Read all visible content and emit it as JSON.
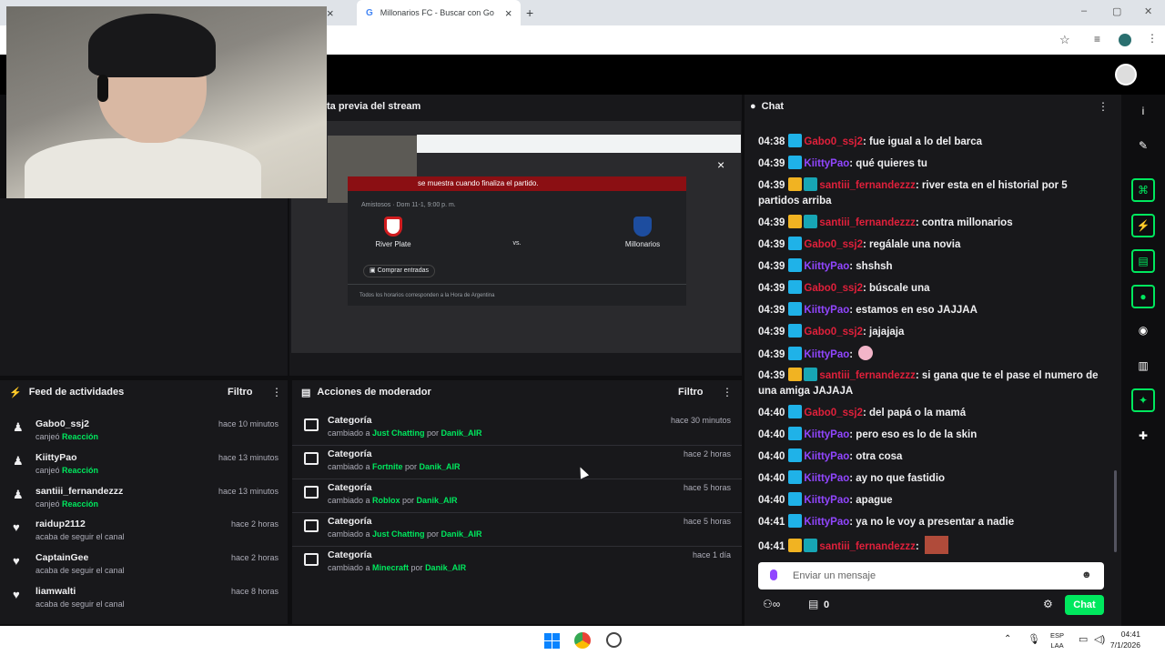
{
  "browser": {
    "tab_title": "Millonarios FC - Buscar con Go",
    "close_glyph": "×",
    "new_tab_glyph": "+"
  },
  "preview": {
    "title": "ta previa del stream",
    "result_banner": "se muestra cuando finaliza el partido.",
    "match_info": "Amistosos · Dom 11-1, 9:00 p. m.",
    "home_team": "River Plate",
    "vs": "vs.",
    "away_team": "Millonarios",
    "buy_tickets": "Comprar entradas",
    "footnote": "Todos los horarios corresponden a la Hora de Argentina",
    "close_glyph": "×"
  },
  "activity_feed": {
    "title": "Feed de actividades",
    "filter_label": "Filtro",
    "items": [
      {
        "user": "Gabo0_ssj2",
        "prefix": "canjeó ",
        "highlight": "Reacción",
        "time": "hace 10 minutos",
        "icon": "♟"
      },
      {
        "user": "KiittyPao",
        "prefix": "canjeó ",
        "highlight": "Reacción",
        "time": "hace 13 minutos",
        "icon": "♟"
      },
      {
        "user": "santiii_fernandezzz",
        "prefix": "canjeó ",
        "highlight": "Reacción",
        "time": "hace 13 minutos",
        "icon": "♟"
      },
      {
        "user": "raidup2112",
        "prefix": "acaba de seguir el canal",
        "highlight": "",
        "time": "hace 2 horas",
        "icon": "♥"
      },
      {
        "user": "CaptainGee",
        "prefix": "acaba de seguir el canal",
        "highlight": "",
        "time": "hace 2 horas",
        "icon": "♥"
      },
      {
        "user": "liamwalti",
        "prefix": "acaba de seguir el canal",
        "highlight": "",
        "time": "hace 8 horas",
        "icon": "♥"
      }
    ]
  },
  "mod_actions": {
    "title": "Acciones de moderador",
    "filter_label": "Filtro",
    "items": [
      {
        "title": "Categoría",
        "prefix": "cambiado a ",
        "category": "Just Chatting",
        "by": " por ",
        "mod": "Danik_AIR",
        "time": "hace 30 minutos"
      },
      {
        "title": "Categoría",
        "prefix": "cambiado a ",
        "category": "Fortnite",
        "by": " por ",
        "mod": "Danik_AIR",
        "time": "hace 2 horas"
      },
      {
        "title": "Categoría",
        "prefix": "cambiado a ",
        "category": "Roblox",
        "by": " por ",
        "mod": "Danik_AIR",
        "time": "hace 5 horas"
      },
      {
        "title": "Categoría",
        "prefix": "cambiado a ",
        "category": "Just Chatting",
        "by": " por ",
        "mod": "Danik_AIR",
        "time": "hace 5 horas"
      },
      {
        "title": "Categoría",
        "prefix": "cambiado a ",
        "category": "Minecraft",
        "by": " por ",
        "mod": "Danik_AIR",
        "time": "hace 1 día"
      }
    ]
  },
  "chat": {
    "title": "Chat",
    "messages": [
      {
        "time": "04:38",
        "user": "Gabo0_ssj2",
        "color": "#e0203b",
        "badges": [
          "prime"
        ],
        "text": ": fue igual a lo del barca"
      },
      {
        "time": "04:39",
        "user": "KiittyPao",
        "color": "#9146ff",
        "badges": [
          "prime"
        ],
        "text": ": qué quieres tu"
      },
      {
        "time": "04:39",
        "user": "santiii_fernandezzz",
        "color": "#e0203b",
        "badges": [
          "crown",
          "gift"
        ],
        "text": ": river esta en el historial por 5 partidos arriba"
      },
      {
        "time": "04:39",
        "user": "santiii_fernandezzz",
        "color": "#e0203b",
        "badges": [
          "crown",
          "gift"
        ],
        "text": ": contra millonarios"
      },
      {
        "time": "04:39",
        "user": "Gabo0_ssj2",
        "color": "#e0203b",
        "badges": [
          "prime"
        ],
        "text": ": regálale una novia"
      },
      {
        "time": "04:39",
        "user": "KiittyPao",
        "color": "#9146ff",
        "badges": [
          "prime"
        ],
        "text": ": shshsh"
      },
      {
        "time": "04:39",
        "user": "Gabo0_ssj2",
        "color": "#e0203b",
        "badges": [
          "prime"
        ],
        "text": ": búscale una"
      },
      {
        "time": "04:39",
        "user": "KiittyPao",
        "color": "#9146ff",
        "badges": [
          "prime"
        ],
        "text": ": estamos en eso JAJJAA"
      },
      {
        "time": "04:39",
        "user": "Gabo0_ssj2",
        "color": "#e0203b",
        "badges": [
          "prime"
        ],
        "text": ": jajajaja"
      },
      {
        "time": "04:39",
        "user": "KiittyPao",
        "color": "#9146ff",
        "badges": [
          "prime"
        ],
        "text": ":"
      },
      {
        "time": "04:39",
        "user": "santiii_fernandezzz",
        "color": "#e0203b",
        "badges": [
          "crown",
          "gift"
        ],
        "text": ": si gana que te el pase el numero de una amiga JAJAJA"
      },
      {
        "time": "04:40",
        "user": "Gabo0_ssj2",
        "color": "#e0203b",
        "badges": [
          "prime"
        ],
        "text": ": del papá o la mamá"
      },
      {
        "time": "04:40",
        "user": "KiittyPao",
        "color": "#9146ff",
        "badges": [
          "prime"
        ],
        "text": ": pero eso es lo de la skin"
      },
      {
        "time": "04:40",
        "user": "KiittyPao",
        "color": "#9146ff",
        "badges": [
          "prime"
        ],
        "text": ": otra cosa"
      },
      {
        "time": "04:40",
        "user": "KiittyPao",
        "color": "#9146ff",
        "badges": [
          "prime"
        ],
        "text": ": ay no que fastidio"
      },
      {
        "time": "04:40",
        "user": "KiittyPao",
        "color": "#9146ff",
        "badges": [
          "prime"
        ],
        "text": ": apague"
      },
      {
        "time": "04:41",
        "user": "KiittyPao",
        "color": "#9146ff",
        "badges": [
          "prime"
        ],
        "text": ": ya no le voy a presentar a nadie"
      },
      {
        "time": "04:41",
        "user": "santiii_fernandezzz",
        "color": "#e0203b",
        "badges": [
          "crown",
          "gift"
        ],
        "text": ":"
      }
    ],
    "input_placeholder": "Enviar un mensaje",
    "points_count": "0",
    "send_label": "Chat"
  },
  "taskbar": {
    "lang_top": "ESP",
    "lang_bottom": "LAA",
    "clock_time": "04:41",
    "clock_date": "7/1/2026"
  },
  "colors": {
    "accent_green": "#00e85e",
    "twitch_purple": "#9146ff",
    "user_red": "#e0203b",
    "panel_bg": "#18181b"
  }
}
